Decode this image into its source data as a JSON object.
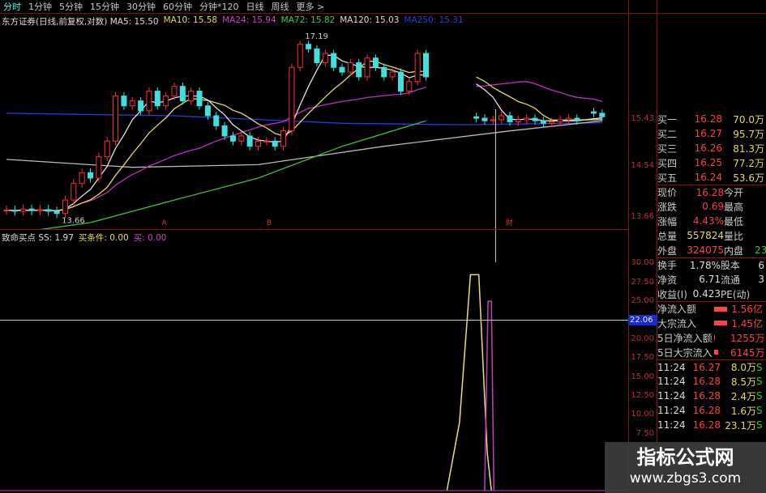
{
  "period_tabs": [
    "分时",
    "1分钟",
    "5分钟",
    "15分钟",
    "30分钟",
    "60分钟",
    "分钟*120",
    "日线",
    "周线",
    "更多 >"
  ],
  "active_tab": "分时",
  "ma_legend": [
    {
      "text": "东方证券(日线,前复权,对数) MA5: 15.50",
      "color": "#dddddd"
    },
    {
      "text": "MA10: 15.58",
      "color": "#e8d860"
    },
    {
      "text": "MA24: 15.94",
      "color": "#d040d0"
    },
    {
      "text": "MA72: 15.82",
      "color": "#40d040"
    },
    {
      "text": "MA120: 15.03",
      "color": "#dddddd"
    },
    {
      "text": "MA250: 15.31",
      "color": "#2a3ae0"
    }
  ],
  "indicator_legend": [
    {
      "text": "致命买点 SS: 1.97",
      "color": "#dddddd"
    },
    {
      "text": "买条件: 0.00",
      "color": "#e8d860"
    },
    {
      "text": "买: 0.00",
      "color": "#d040d0"
    }
  ],
  "price_axis": [
    "15.43",
    "14.54",
    "13.66"
  ],
  "indicator_axis": [
    "30.00",
    "27.50",
    "25.00",
    "20.00",
    "17.50",
    "15.00",
    "12.50",
    "10.00",
    "7.50"
  ],
  "crosshair_value": "22.06",
  "chart_data": {
    "type": "candlestick",
    "scale": "log",
    "closes": [
      13.72,
      13.7,
      13.74,
      13.71,
      13.73,
      13.7,
      13.66,
      13.9,
      14.2,
      14.4,
      14.3,
      14.7,
      15.0,
      15.9,
      15.7,
      15.8,
      15.6,
      16.0,
      15.7,
      15.9,
      16.1,
      15.8,
      16.0,
      15.7,
      15.5,
      15.3,
      15.1,
      15.0,
      15.1,
      14.9,
      15.0,
      15.0,
      14.9,
      15.2,
      16.5,
      17.0,
      16.9,
      16.6,
      16.8,
      16.5,
      16.4,
      16.6,
      16.3,
      16.7,
      16.5,
      16.3,
      16.4,
      16.0,
      16.2,
      16.8,
      16.3,
      null,
      null,
      null,
      null,
      null,
      15.45,
      15.4,
      15.42,
      15.5,
      15.38,
      15.42,
      15.45,
      15.4,
      15.35,
      15.38,
      15.42,
      15.45,
      15.4,
      null,
      15.55,
      15.48
    ],
    "high_label": "17.19",
    "low_label": "13.66",
    "ma72": [
      [
        0,
        13.3
      ],
      [
        10,
        13.5
      ],
      [
        20,
        13.9
      ],
      [
        30,
        14.3
      ],
      [
        40,
        14.9
      ],
      [
        50,
        15.4
      ]
    ],
    "ma120": [
      [
        0,
        14.65
      ],
      [
        15,
        14.5
      ],
      [
        30,
        14.55
      ],
      [
        45,
        14.9
      ],
      [
        60,
        15.2
      ],
      [
        71,
        15.4
      ]
    ],
    "ma250": [
      [
        0,
        15.55
      ],
      [
        20,
        15.5
      ],
      [
        40,
        15.35
      ],
      [
        55,
        15.32
      ],
      [
        71,
        15.36
      ]
    ],
    "markers": [
      {
        "slot": 18.5,
        "text": "A"
      },
      {
        "slot": 31,
        "text": "B"
      },
      {
        "slot": 59.5,
        "text": "财"
      }
    ],
    "indicator": {
      "ylim": [
        0,
        31
      ],
      "buy_condition": [
        [
          52.5,
          0
        ],
        [
          54,
          9
        ],
        [
          55.3,
          28.5
        ],
        [
          56.3,
          28.5
        ],
        [
          57.3,
          5
        ],
        [
          57.8,
          0
        ]
      ],
      "buy": [
        [
          57,
          0
        ],
        [
          57.4,
          25
        ],
        [
          57.8,
          25
        ],
        [
          58.1,
          0
        ]
      ]
    }
  },
  "quote": {
    "bids": [
      [
        "买一",
        "16.28",
        "70.0万"
      ],
      [
        "买二",
        "16.27",
        "95.7万"
      ],
      [
        "买三",
        "16.26",
        "81.3万"
      ],
      [
        "买四",
        "16.25",
        "77.2万"
      ],
      [
        "买五",
        "16.24",
        "53.6万"
      ]
    ],
    "stats": [
      [
        "现价",
        "16.28",
        "今开",
        ""
      ],
      [
        "涨跌",
        "0.69",
        "最高",
        ""
      ],
      [
        "涨幅",
        "4.43%",
        "最低",
        ""
      ],
      [
        "总量",
        "557824",
        "量比",
        ""
      ],
      [
        "外盘",
        "324075",
        "内盘",
        "23"
      ]
    ],
    "stats2": [
      [
        "换手",
        "1.78%",
        "股本",
        "6"
      ],
      [
        "净资",
        "6.71",
        "流通",
        "3"
      ],
      [
        "收益(I)",
        "0.423",
        "PE(动)",
        ""
      ]
    ],
    "flows": [
      [
        "净流入额",
        "1.56亿"
      ],
      [
        "大宗流入",
        "1.45亿"
      ],
      [
        "5日净流入额",
        "1255万"
      ],
      [
        "5日大宗流入",
        "6145万"
      ]
    ],
    "ticks": [
      [
        "11:24",
        "16.27",
        "8.0万",
        "S"
      ],
      [
        "11:24",
        "16.28",
        "8.5万",
        "S"
      ],
      [
        "11:24",
        "16.28",
        "2.4万",
        "S"
      ],
      [
        "11:24",
        "16.28",
        "1.6万",
        "S"
      ],
      [
        "11:24",
        "16.28",
        "23.1万",
        "S"
      ]
    ]
  },
  "watermark": {
    "title": "指标公式网",
    "url": "www.zbgs3.com"
  }
}
